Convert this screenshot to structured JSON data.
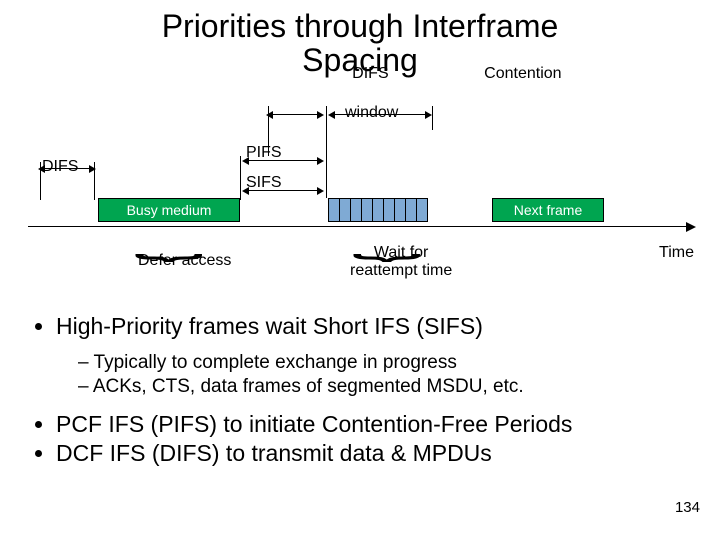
{
  "title_line1": "Priorities through Interframe",
  "title_line2": "Spacing",
  "overlap_difs": "DIFS",
  "overlap_contention": "Contention",
  "window_label": "window",
  "left_difs": "DIFS",
  "pifs_label": "PIFS",
  "sifs_label": "SIFS",
  "busy_label": "Busy medium",
  "next_label": "Next frame",
  "time_label": "Time",
  "defer_label": "Defer access",
  "wait_line1": "Wait for",
  "wait_line2": "reattempt time",
  "bullet1": "High-Priority frames wait Short IFS (SIFS)",
  "sub1": "Typically to complete exchange in progress",
  "sub2": "ACKs, CTS, data frames of segmented MSDU, etc.",
  "bullet2": "PCF IFS (PIFS) to initiate Contention-Free Periods",
  "bullet3": "DCF IFS (DIFS) to transmit data & MPDUs",
  "page_number": "134"
}
